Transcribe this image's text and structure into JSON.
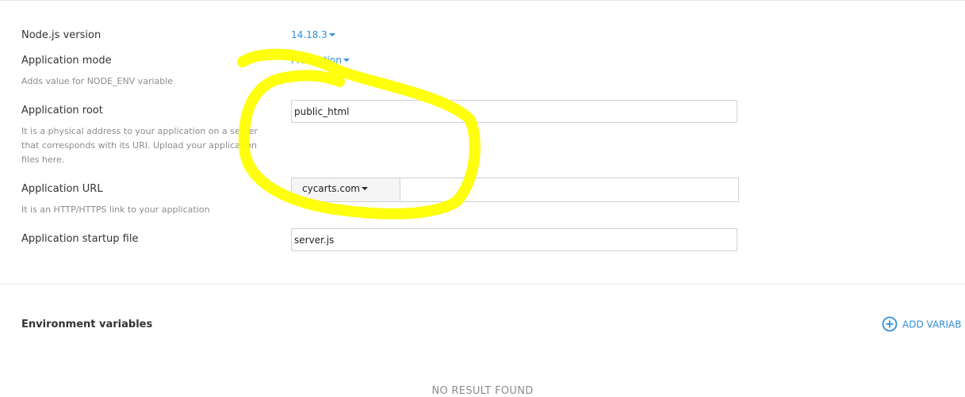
{
  "form": {
    "node_version": {
      "label": "Node.js version",
      "value": "14.18.3"
    },
    "app_mode": {
      "label": "Application mode",
      "value": "Production",
      "hint": "Adds value for NODE_ENV variable"
    },
    "app_root": {
      "label": "Application root",
      "value": "public_html",
      "hint": "It is a physical address to your application on a server that corresponds with its URI. Upload your application files here."
    },
    "app_url": {
      "label": "Application URL",
      "domain": "cycarts.com",
      "path": "",
      "hint": "It is an HTTP/HTTPS link to your application"
    },
    "startup_file": {
      "label": "Application startup file",
      "value": "server.js"
    }
  },
  "env_vars": {
    "title": "Environment variables",
    "add_label": "ADD VARIAB",
    "empty_text": "NO RESULT FOUND"
  },
  "colors": {
    "link": "#2f8ed7",
    "annotation_highlight": "#ffff00"
  },
  "icons": {
    "dropdown": "caret-down-icon",
    "add": "plus-circle-icon"
  }
}
